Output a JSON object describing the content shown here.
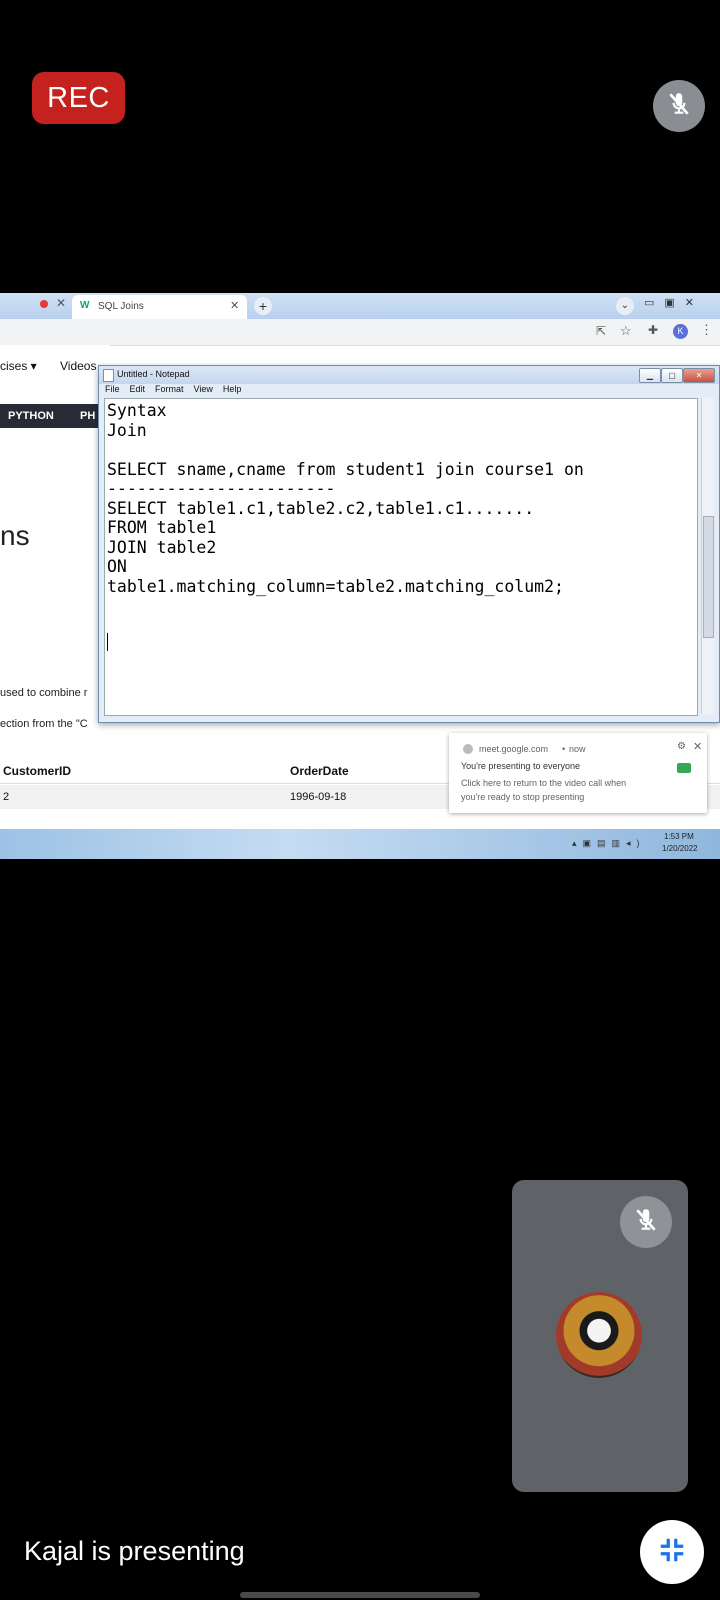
{
  "rec_label": "REC",
  "presenter_caption": "Kajal is presenting",
  "browser": {
    "active_tab_title": "SQL Joins",
    "site_nav": {
      "exercises_label": "cises ▾",
      "videos_label": "Videos",
      "python_label": "PYTHON",
      "php_label": "PH"
    },
    "page": {
      "heading_fragment": "ns",
      "line1": "used to combine r",
      "line2": "ection from the \"C"
    },
    "orders_table": {
      "headers": [
        "CustomerID",
        "OrderDate"
      ],
      "rows": [
        [
          "2",
          "1996-09-18"
        ]
      ]
    },
    "taskbar_clock": {
      "time": "1:53 PM",
      "date": "1/20/2022"
    }
  },
  "notepad": {
    "title": "Untitled - Notepad",
    "menu": [
      "File",
      "Edit",
      "Format",
      "View",
      "Help"
    ],
    "lines": [
      "Syntax",
      "Join",
      "",
      "SELECT sname,cname from student1 join course1 on",
      "-----------------------",
      "SELECT table1.c1,table2.c2,table1.c1.......",
      "FROM table1",
      "JOIN table2",
      "ON",
      "table1.matching_column=table2.matching_colum2;"
    ]
  },
  "toast": {
    "source": "meet.google.com",
    "time": "now",
    "title": "You're presenting to everyone",
    "body": "Click here to return to the video call when you're ready to stop presenting"
  },
  "icons": {
    "top_right": "mic-off-icon",
    "tile": "mic-off-icon",
    "exit": "exit-fullscreen-icon"
  },
  "colors": {
    "rec_red": "#c5221f",
    "tile_gray": "#5f6368",
    "mic_gray": "#8a8d91"
  }
}
